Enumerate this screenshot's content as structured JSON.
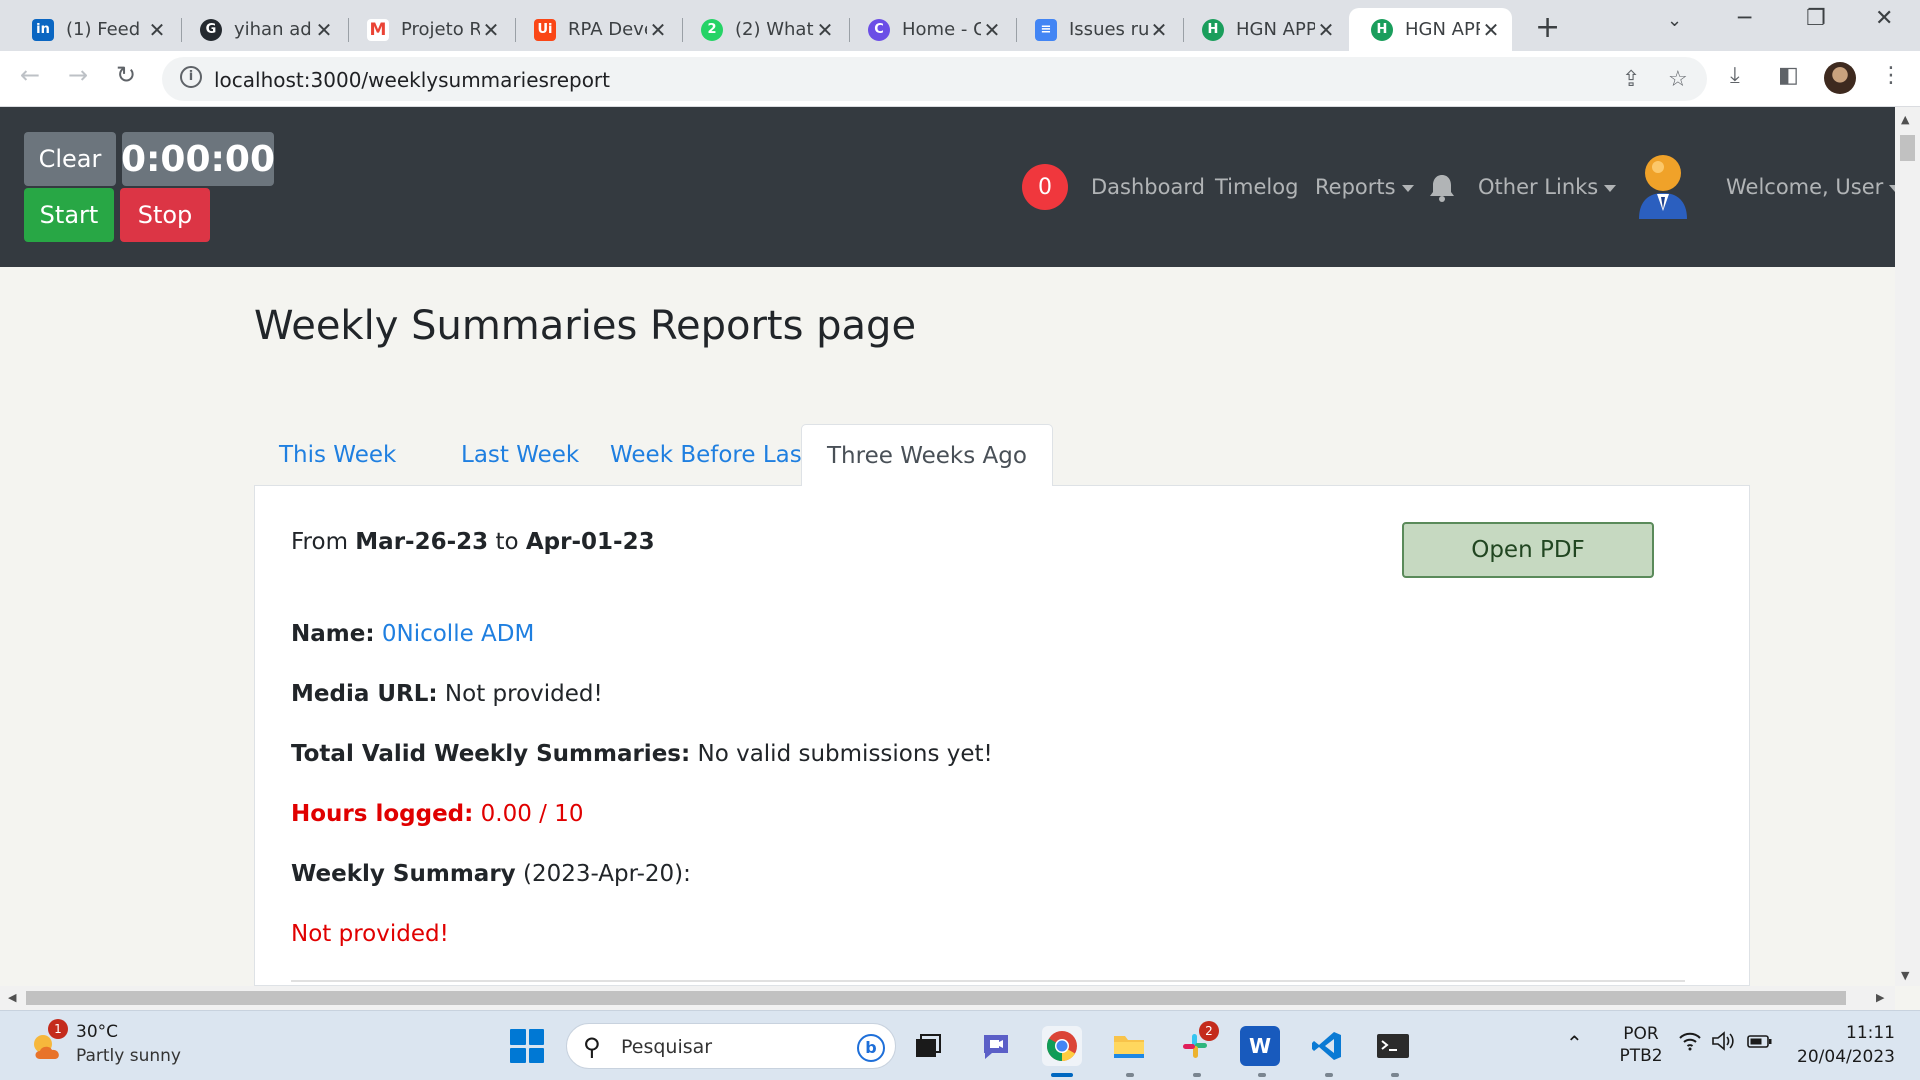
{
  "browser": {
    "tabs": [
      {
        "title": "(1) Feed",
        "icon": "linkedin-icon",
        "color": "#0a66c2",
        "glyph": "in"
      },
      {
        "title": "yihan ad",
        "icon": "github-icon",
        "color": "#24292f",
        "glyph": "G"
      },
      {
        "title": "Projeto R",
        "icon": "gmail-icon",
        "color": "#ea4335",
        "glyph": "M"
      },
      {
        "title": "RPA Deve",
        "icon": "uipath-icon",
        "color": "#fa4616",
        "glyph": "Ui"
      },
      {
        "title": "(2) What",
        "icon": "whatsapp-icon",
        "color": "#25d366",
        "glyph": "2"
      },
      {
        "title": "Home - C",
        "icon": "canva-icon",
        "color": "#6b4ee6",
        "glyph": "C"
      },
      {
        "title": "Issues ru",
        "icon": "docs-icon",
        "color": "#4285f4",
        "glyph": "≡"
      },
      {
        "title": "HGN APP",
        "icon": "hgn-icon",
        "color": "#1a9e5c",
        "glyph": "H"
      },
      {
        "title": "HGN APP",
        "icon": "hgn-icon",
        "color": "#1a9e5c",
        "glyph": "H"
      }
    ],
    "url": "localhost:3000/weeklysummariesreport"
  },
  "header": {
    "clear_label": "Clear",
    "timer": "0:00:00",
    "start_label": "Start",
    "stop_label": "Stop",
    "notification_count": "0",
    "nav": {
      "dashboard": "Dashboard",
      "timelog": "Timelog",
      "reports": "Reports",
      "other_links": "Other Links",
      "welcome": "Welcome, User"
    }
  },
  "page": {
    "title": "Weekly Summaries Reports page",
    "tabs": [
      "This Week",
      "Last Week",
      "Week Before Last",
      "Three Weeks Ago"
    ],
    "active_tab": "Three Weeks Ago",
    "report": {
      "from_prefix": "From",
      "from_date": "Mar-26-23",
      "to_word": "to",
      "to_date": "Apr-01-23",
      "open_pdf": "Open PDF",
      "name_label": "Name:",
      "name_value": "0Nicolle ADM",
      "media_label": "Media URL:",
      "media_value": "Not provided!",
      "total_label": "Total Valid Weekly Summaries:",
      "total_value": "No valid submissions yet!",
      "hours_label": "Hours logged:",
      "hours_value": "0.00 / 10",
      "summary_label": "Weekly Summary",
      "summary_date": "(2023-Apr-20):",
      "summary_value": "Not provided!"
    }
  },
  "taskbar": {
    "weather_badge": "1",
    "weather_temp": "30°C",
    "weather_desc": "Partly sunny",
    "search_placeholder": "Pesquisar",
    "slack_badge": "2",
    "lang_top": "POR",
    "lang_bottom": "PTB2",
    "time": "11:11",
    "date": "20/04/2023"
  },
  "colors": {
    "header_bg": "#343a40",
    "link_blue": "#1f7fe0",
    "alert_red": "#e00000",
    "start_green": "#28a745",
    "stop_red": "#dc3545"
  }
}
